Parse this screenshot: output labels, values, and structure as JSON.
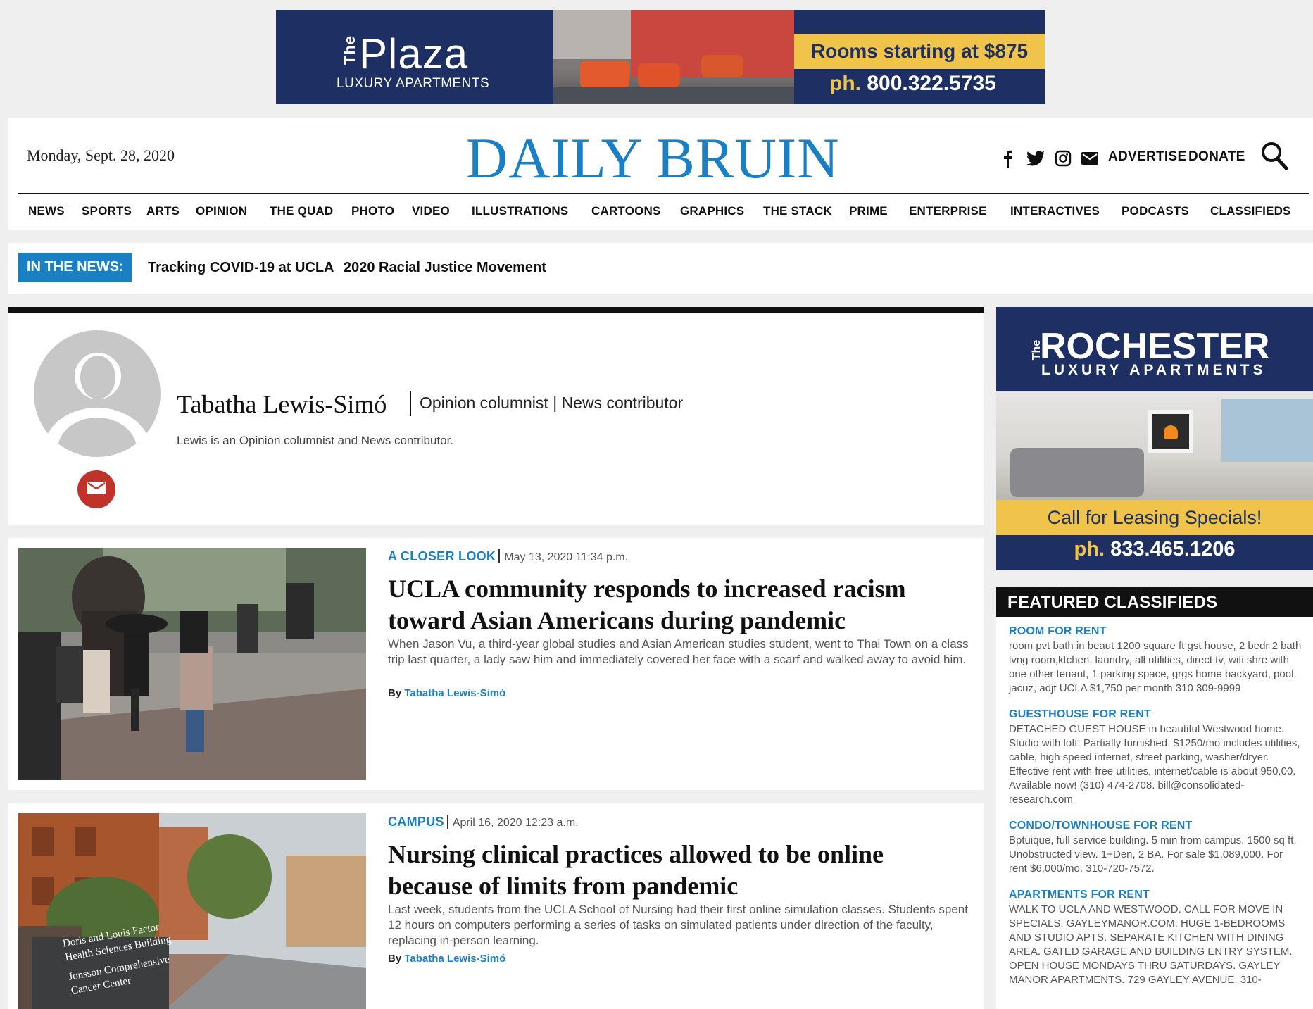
{
  "top_ad": {
    "the": "The",
    "brand": "Plaza",
    "subtitle": "LUXURY APARTMENTS",
    "rooms": "Rooms starting at $875",
    "phone_prefix": "ph.",
    "phone": "800.322.5735"
  },
  "header": {
    "date": "Monday, Sept. 28, 2020",
    "logo": "DAILY BRUIN",
    "social_icons": [
      "facebook-icon",
      "twitter-icon",
      "instagram-icon",
      "email-icon"
    ],
    "advertise": "ADVERTISE",
    "donate": "DONATE",
    "logo_color": "#1b7fc4"
  },
  "nav": [
    "NEWS",
    "SPORTS",
    "ARTS",
    "OPINION",
    "THE QUAD",
    "PHOTO",
    "VIDEO",
    "ILLUSTRATIONS",
    "CARTOONS",
    "GRAPHICS",
    "THE STACK",
    "PRIME",
    "ENTERPRISE",
    "INTERACTIVES",
    "PODCASTS",
    "CLASSIFIEDS"
  ],
  "in_the_news": {
    "label": "IN THE NEWS:",
    "links": [
      "Tracking COVID-19 at UCLA",
      "2020 Racial Justice Movement"
    ]
  },
  "author": {
    "name": "Tabatha Lewis-Simó",
    "role": "Opinion columnist | News contributor",
    "bio": "Lewis is an Opinion columnist and News contributor."
  },
  "articles": [
    {
      "category": "A CLOSER LOOK",
      "date": "May 13, 2020 11:34 p.m.",
      "title": "UCLA community responds to increased racism toward Asian Americans during pandemic",
      "description": "When Jason Vu, a third-year global studies and Asian American studies student, went to Thai Town on a class trip last quarter, a lady saw him and immediately covered her face with a scarf and walked away to avoid him.",
      "by": "By",
      "author": "Tabatha Lewis-Simó"
    },
    {
      "category": "CAMPUS",
      "date": "April 16, 2020 12:23 a.m.",
      "title": "Nursing clinical practices allowed to be online because of limits from pandemic",
      "description": "Last week, students from the UCLA School of Nursing had their first online simulation classes. Students spent 12 hours on computers performing a series of tasks on simulated patients under direction of the faculty, replacing in-person learning.",
      "by": "By",
      "author": "Tabatha Lewis-Simó",
      "photo_sign": [
        "Doris and Louis Factor",
        "Health Sciences Building",
        "Jonsson Comprehensive",
        "Cancer Center"
      ]
    }
  ],
  "side_ad": {
    "the": "The",
    "brand": "ROCHESTER",
    "subtitle": "LUXURY APARTMENTS",
    "call": "Call for Leasing Specials!",
    "phone_prefix": "ph.",
    "phone": "833.465.1206"
  },
  "classifieds": {
    "heading": "FEATURED CLASSIFIEDS",
    "items": [
      {
        "title": "ROOM FOR RENT",
        "text": "room pvt bath in beaut 1200 square ft gst house, 2 bedr 2 bath lvng room,ktchen, laundry, all utilities, direct tv, wifi shre with one other tenant, 1 parking space, grgs home backyard, pool, jacuz, adjt UCLA $1,750 per month 310 309-9999"
      },
      {
        "title": "GUESTHOUSE FOR RENT",
        "text": "DETACHED GUEST HOUSE in beautiful Westwood home. Studio with loft. Partially furnished. $1250/mo includes utilities, cable, high speed internet, street parking, washer/dryer. Effective rent with free utilities, internet/cable is about 950.00. Available now! (310) 474-2708. bill@consolidated-research.com"
      },
      {
        "title": "CONDO/TOWNHOUSE FOR RENT",
        "text": "Bptuique, full service building. 5 min from campus. 1500 sq ft. Unobstructed view. 1+Den, 2 BA. For sale $1,089,000. For rent $6,000/mo. 310-720-7572."
      },
      {
        "title": "APARTMENTS FOR RENT",
        "text": "WALK TO UCLA AND WESTWOOD. CALL FOR MOVE IN SPECIALS. GAYLEYMANOR.COM. HUGE 1-BEDROOMS AND STUDIO APTS. SEPARATE KITCHEN WITH DINING AREA. GATED GARAGE AND BUILDING ENTRY SYSTEM. OPEN HOUSE MONDAYS THRU SATURDAYS. GAYLEY MANOR APARTMENTS. 729 GAYLEY AVENUE. 310-"
      }
    ]
  }
}
